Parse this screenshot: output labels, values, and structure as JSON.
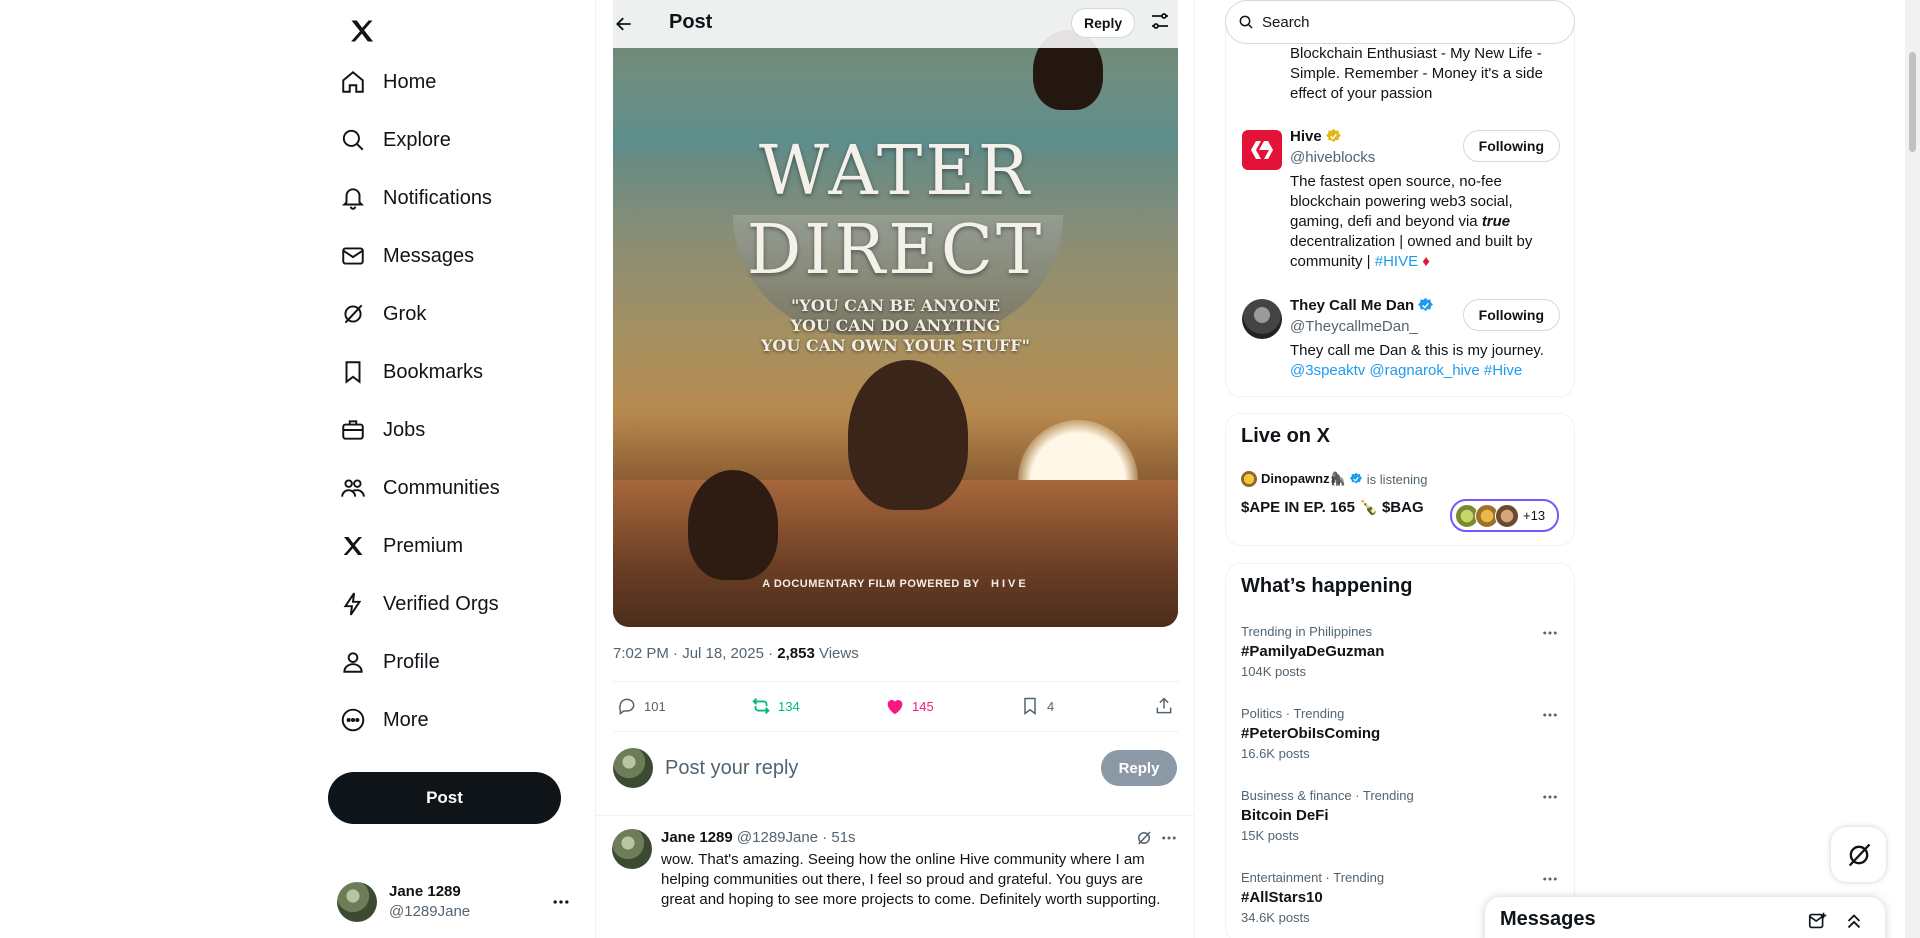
{
  "nav": {
    "items": [
      {
        "label": "Home",
        "icon": "home-icon"
      },
      {
        "label": "Explore",
        "icon": "search-icon"
      },
      {
        "label": "Notifications",
        "icon": "bell-icon"
      },
      {
        "label": "Messages",
        "icon": "envelope-icon"
      },
      {
        "label": "Grok",
        "icon": "grok-icon"
      },
      {
        "label": "Bookmarks",
        "icon": "bookmark-icon"
      },
      {
        "label": "Jobs",
        "icon": "briefcase-icon"
      },
      {
        "label": "Communities",
        "icon": "people-icon"
      },
      {
        "label": "Premium",
        "icon": "x-logo-icon"
      },
      {
        "label": "Verified Orgs",
        "icon": "lightning-icon"
      },
      {
        "label": "Profile",
        "icon": "person-icon"
      },
      {
        "label": "More",
        "icon": "more-circle-icon"
      }
    ],
    "post_label": "Post"
  },
  "account": {
    "name": "Jane 1289",
    "handle": "@1289Jane"
  },
  "header": {
    "title": "Post",
    "reply_label": "Reply"
  },
  "poster": {
    "title": "WATER DIRECT",
    "quote_lines": [
      "\"YOU CAN BE ANYONE",
      "YOU CAN DO ANYTING",
      "YOU CAN OWN YOUR STUFF\""
    ],
    "credit": "A DOCUMENTARY FILM POWERED BY",
    "brand": "HIVE"
  },
  "tweet": {
    "time": "7:02 PM · Jul 18, 2025 · ",
    "views_count": "2,853",
    "views_label": " Views",
    "replies": "101",
    "reposts": "134",
    "likes": "145",
    "bookmarks": "4"
  },
  "composer": {
    "placeholder": "Post your reply",
    "button": "Reply"
  },
  "reply": {
    "name": "Jane 1289",
    "handle": "@1289Jane",
    "age": "· 51s",
    "text": "wow. That's amazing. Seeing how the online Hive community where I am helping communities out there, I feel so proud and grateful. You guys are great and hoping to see more projects to come. Definitely worth supporting."
  },
  "search": {
    "placeholder": "Search"
  },
  "who_to_follow": {
    "partial_bio": "Blockchain Enthusiast - My New Life - Simple. Remember - Money it's a side effect of your passion",
    "accounts": [
      {
        "name": "Hive",
        "handle": "@hiveblocks",
        "button": "Following",
        "bio_parts": [
          "The fastest open source, no-fee blockchain powering web3 social, gaming, defi and beyond via ",
          "true",
          " decentralization | owned and built by community | ",
          "#HIVE",
          " ♦"
        ],
        "badge_color": "#e2b719"
      },
      {
        "name": "They Call Me Dan",
        "handle": "@TheycallmeDan_",
        "button": "Following",
        "bio_text": "They call me Dan & this is my journey.",
        "bio_links": "@3speaktv @ragnarok_hive #Hive",
        "badge_color": "#1d9bf0"
      }
    ]
  },
  "live": {
    "title": "Live on X",
    "host": "Dinopawnz🦍",
    "status": "is listening",
    "space_title": "$APE IN EP. 165 🍾 $BAG",
    "more": "+13"
  },
  "trends": {
    "title": "What’s happening",
    "items": [
      {
        "context": "Trending in Philippines",
        "topic": "#PamilyaDeGuzman",
        "count": "104K posts"
      },
      {
        "context": "Politics · Trending",
        "topic": "#PeterObiIsComing",
        "count": "16.6K posts"
      },
      {
        "context": "Business & finance · Trending",
        "topic": "Bitcoin DeFi",
        "count": "15K posts"
      },
      {
        "context": "Entertainment · Trending",
        "topic": "#AllStars10",
        "count": "34.6K posts"
      }
    ]
  },
  "messages_drawer": {
    "title": "Messages"
  },
  "colors": {
    "accent": "#1d9bf0",
    "like": "#f91880",
    "repost": "#00ba7c",
    "hive": "#e31337"
  }
}
